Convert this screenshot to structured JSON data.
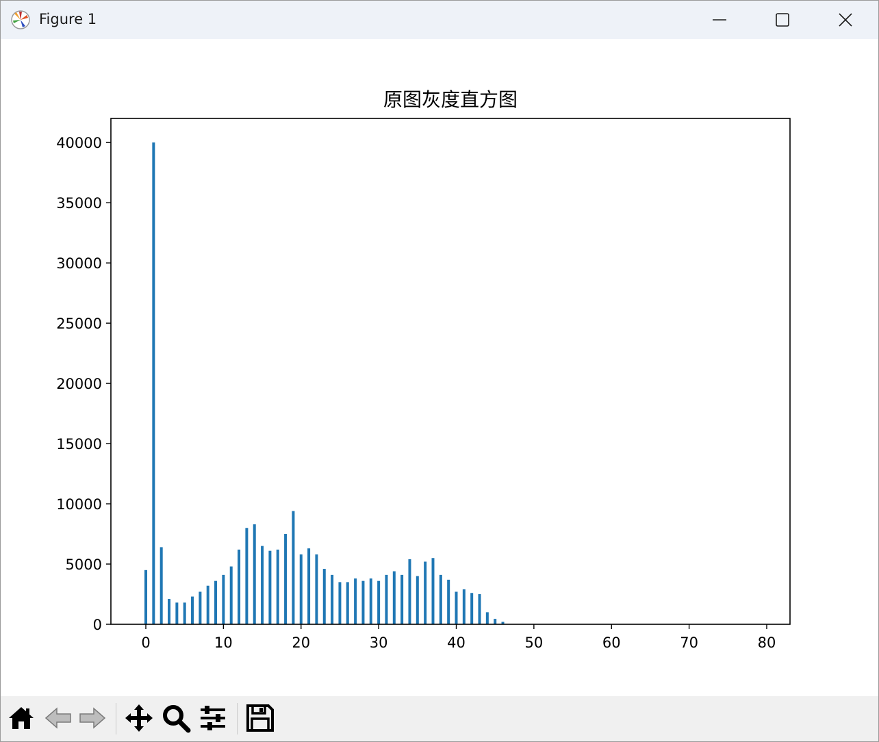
{
  "window": {
    "title": "Figure 1",
    "controls": [
      "minimize-icon",
      "maximize-icon",
      "close-icon"
    ]
  },
  "toolbar": {
    "buttons": [
      {
        "name": "home-button",
        "icon": "home-icon"
      },
      {
        "name": "back-button",
        "icon": "left-arrow-icon"
      },
      {
        "name": "forward-button",
        "icon": "right-arrow-icon"
      },
      {
        "name": "pan-button",
        "icon": "move-icon"
      },
      {
        "name": "zoom-button",
        "icon": "magnifier-icon"
      },
      {
        "name": "configure-subplots-button",
        "icon": "sliders-icon"
      },
      {
        "name": "save-button",
        "icon": "floppy-disk-icon"
      }
    ]
  },
  "chart_data": {
    "type": "bar",
    "title": "原图灰度直方图",
    "xlabel": "",
    "ylabel": "",
    "xlim": [
      -4.5,
      83
    ],
    "ylim": [
      0,
      42000
    ],
    "xticks": [
      0,
      10,
      20,
      30,
      40,
      50,
      60,
      70,
      80
    ],
    "yticks": [
      0,
      5000,
      10000,
      15000,
      20000,
      25000,
      30000,
      35000,
      40000
    ],
    "bar_color": "#1f77b4",
    "grid": false,
    "x": [
      0,
      1,
      2,
      3,
      4,
      5,
      6,
      7,
      8,
      9,
      10,
      11,
      12,
      13,
      14,
      15,
      16,
      17,
      18,
      19,
      20,
      21,
      22,
      23,
      24,
      25,
      26,
      27,
      28,
      29,
      30,
      31,
      32,
      33,
      34,
      35,
      36,
      37,
      38,
      39,
      40,
      41,
      42,
      43,
      44,
      45,
      46
    ],
    "values": [
      4500,
      40000,
      6400,
      2100,
      1800,
      1800,
      2300,
      2700,
      3200,
      3600,
      4100,
      4800,
      6200,
      8000,
      8300,
      6500,
      6100,
      6200,
      7500,
      9400,
      5800,
      6300,
      5800,
      4600,
      4100,
      3500,
      3500,
      3800,
      3600,
      3800,
      3600,
      4100,
      4400,
      4100,
      5400,
      4000,
      5200,
      5500,
      4100,
      3700,
      2700,
      2900,
      2600,
      2500,
      1000,
      450,
      200
    ]
  }
}
